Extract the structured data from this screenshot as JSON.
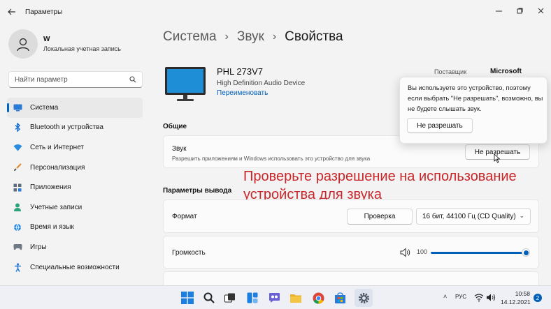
{
  "window": {
    "title": "Параметры",
    "back_icon": "back-arrow-icon",
    "controls": [
      "minimize-icon",
      "maximize-icon",
      "close-icon"
    ]
  },
  "profile": {
    "name": "W",
    "account_type": "Локальная учетная запись"
  },
  "search": {
    "placeholder": "Найти параметр",
    "icon": "search-icon"
  },
  "nav": {
    "items": [
      {
        "label": "Система",
        "icon": "system-icon",
        "active": true
      },
      {
        "label": "Bluetooth и устройства",
        "icon": "bluetooth-icon"
      },
      {
        "label": "Сеть и Интернет",
        "icon": "wifi-icon"
      },
      {
        "label": "Персонализация",
        "icon": "brush-icon"
      },
      {
        "label": "Приложения",
        "icon": "apps-icon"
      },
      {
        "label": "Учетные записи",
        "icon": "account-icon"
      },
      {
        "label": "Время и язык",
        "icon": "globe-icon"
      },
      {
        "label": "Игры",
        "icon": "gamepad-icon"
      },
      {
        "label": "Специальные возможности",
        "icon": "accessibility-icon"
      }
    ]
  },
  "breadcrumb": {
    "items": [
      "Система",
      "Звук"
    ],
    "current": "Свойства"
  },
  "device": {
    "name": "PHL 273V7",
    "driver": "High Definition Audio Device",
    "rename_link": "Переименовать",
    "vendor_label": "Поставщик",
    "vendor_value": "Microsoft"
  },
  "general": {
    "section_title": "Общие",
    "sound_title": "Звук",
    "sound_desc": "Разрешить приложениям и Windows использовать это устройство для звука",
    "deny_button": "Не разрешать"
  },
  "output": {
    "section_title": "Параметры вывода",
    "format_label": "Формат",
    "test_button": "Проверка",
    "format_value": "16 бит, 44100 Гц (CD Quality)",
    "volume_label": "Громкость",
    "volume_value": "100",
    "volume_level": 1.0
  },
  "annotation": {
    "line1": "Проверьте разрешение на использование",
    "line2": "устройства для звука",
    "color": "#c8262a"
  },
  "popup": {
    "message": "Вы используете это устройство, поэтому если выбрать \"Не разрешать\", возможно, вы не будете слышать звук.",
    "button": "Не разрешать"
  },
  "taskbar": {
    "icons": [
      "start-icon",
      "search-icon",
      "task-view-icon",
      "widgets-icon",
      "chat-icon",
      "file-explorer-icon",
      "chrome-icon",
      "store-icon",
      "settings-icon"
    ],
    "language": "РУС",
    "time": "10:58",
    "date": "14.12.2021",
    "notifications": "2"
  },
  "colors": {
    "accent": "#0067c0",
    "link": "#005fb8",
    "annotation": "#c8262a"
  }
}
